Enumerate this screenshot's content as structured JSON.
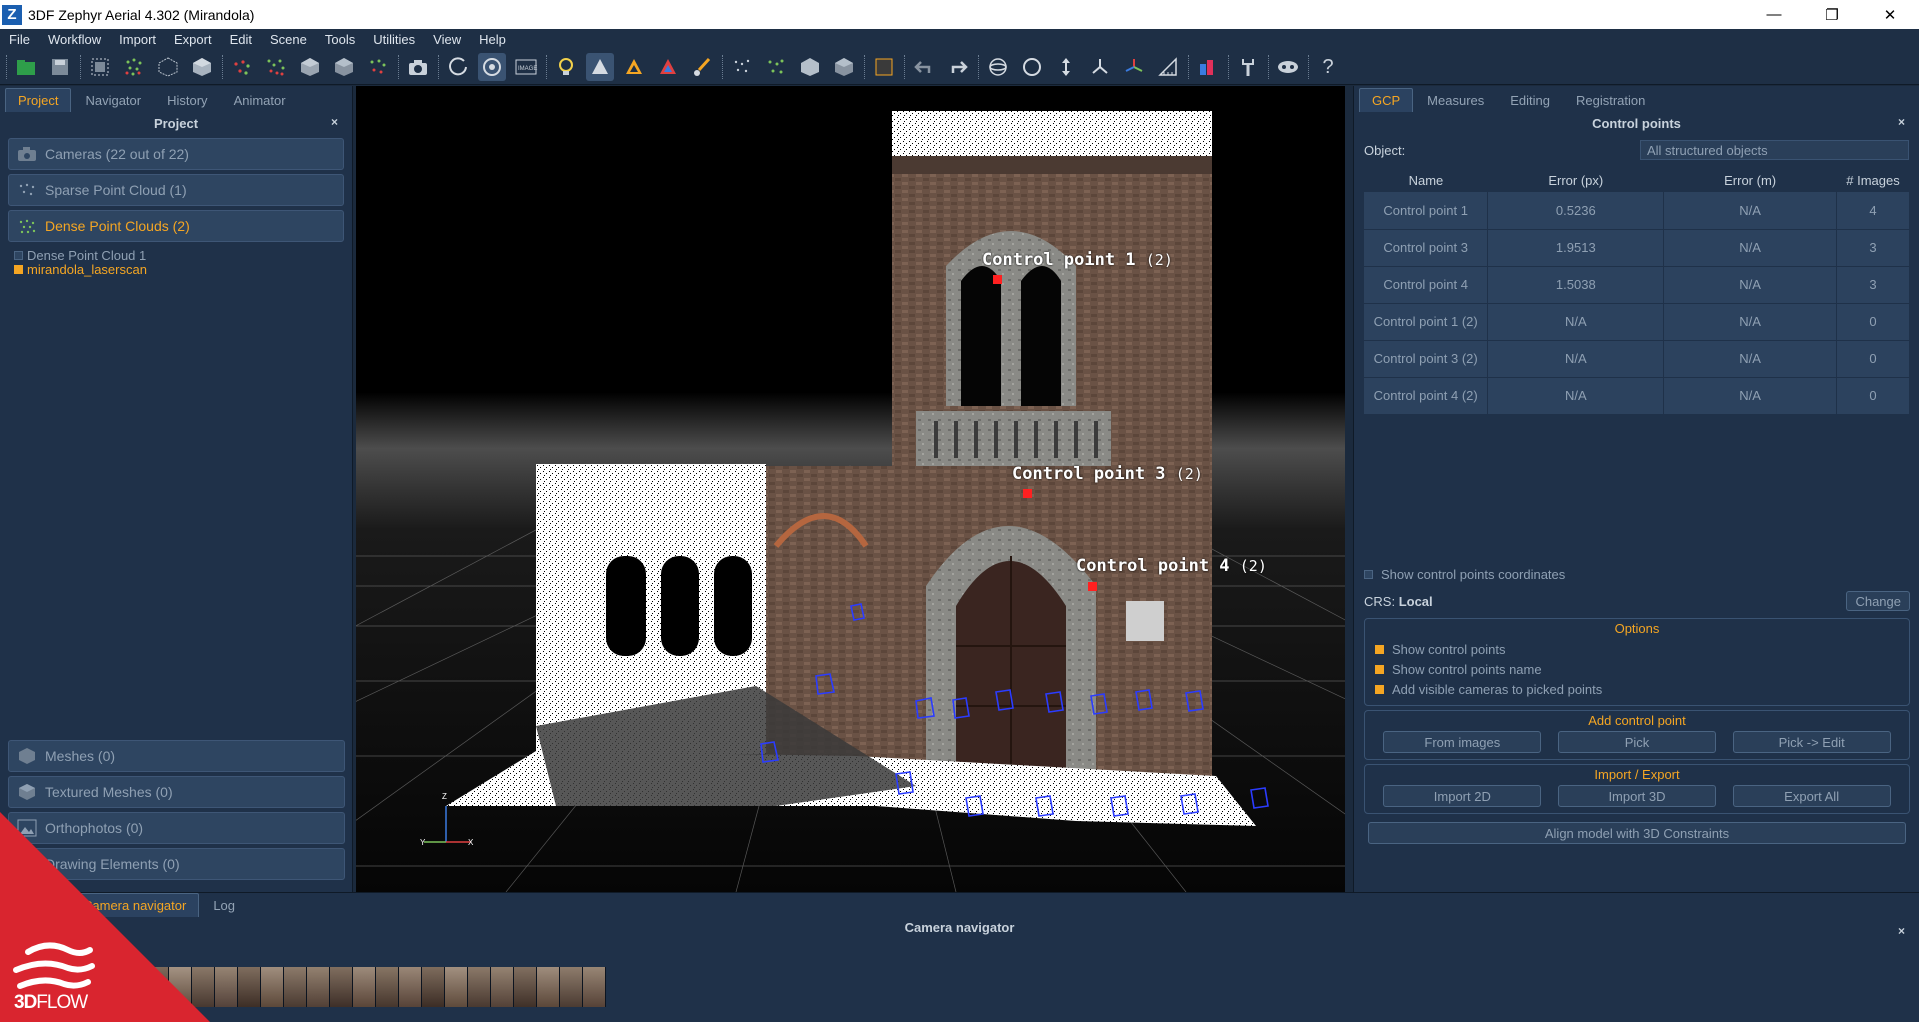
{
  "window": {
    "title": "3DF Zephyr Aerial 4.302 (Mirandola)",
    "logo_letter": "Z",
    "minimize": "—",
    "restore": "❐",
    "close": "✕"
  },
  "menu": [
    "File",
    "Workflow",
    "Import",
    "Export",
    "Edit",
    "Scene",
    "Tools",
    "Utilities",
    "View",
    "Help"
  ],
  "toolbar_icons": [
    "open-project-icon",
    "save-icon",
    "select-region-icon",
    "point-cloud-icon",
    "mesh-icon",
    "cube-icon",
    "sparse-points-icon",
    "dense-points-icon",
    "mesh-solid-icon",
    "textured-mesh-icon",
    "cloud-filter-icon",
    "camera-icon",
    "orbit-icon",
    "pan-rotate-icon",
    "image-icon",
    "light-bulb-icon",
    "point-pick-icon",
    "triangle-icon",
    "color-triangle-icon",
    "brush-icon",
    "dots-icon",
    "points-select-icon",
    "box-icon",
    "box-wire-icon",
    "square-icon",
    "undo-icon",
    "redo-icon",
    "rotate-icon",
    "circle-icon",
    "vertical-arrow-icon",
    "transform-icon",
    "gizmo-icon",
    "measure-icon",
    "analysis-icon",
    "wrench-icon",
    "mask-icon",
    "help-icon"
  ],
  "left": {
    "tabs": [
      "Project",
      "Navigator",
      "History",
      "Animator"
    ],
    "title": "Project",
    "close": "×",
    "sections_top": [
      {
        "label": "Cameras (22 out of 22)",
        "icon": "camera-icon"
      },
      {
        "label": "Sparse Point Cloud (1)",
        "icon": "sparse-cloud-icon"
      },
      {
        "label": "Dense Point Clouds (2)",
        "icon": "dense-cloud-icon"
      }
    ],
    "tree": [
      {
        "label": "Dense Point Cloud 1",
        "checked": false
      },
      {
        "label": "mirandola_laserscan",
        "checked": true
      }
    ],
    "sections_bottom": [
      {
        "label": "Meshes (0)",
        "icon": "mesh-icon"
      },
      {
        "label": "Textured Meshes (0)",
        "icon": "textured-mesh-icon"
      },
      {
        "label": "Orthophotos (0)",
        "icon": "orthophoto-icon"
      },
      {
        "label": "Drawing Elements (0)",
        "icon": "drawing-icon"
      }
    ]
  },
  "viewport": {
    "labels": [
      {
        "name": "Control point 1",
        "suffix": "(2)"
      },
      {
        "name": "Control point 3",
        "suffix": "(2)"
      },
      {
        "name": "Control point 4",
        "suffix": "(2)"
      }
    ],
    "axes": {
      "z": "Z",
      "y": "Y",
      "x": "X"
    }
  },
  "right": {
    "tabs": [
      "GCP",
      "Measures",
      "Editing",
      "Registration"
    ],
    "title": "Control points",
    "close": "×",
    "object_label": "Object:",
    "object_value": "All structured objects",
    "columns": [
      "Name",
      "Error (px)",
      "Error (m)",
      "# Images"
    ],
    "rows": [
      [
        "Control point 1",
        "0.5236",
        "N/A",
        "4"
      ],
      [
        "Control point 3",
        "1.9513",
        "N/A",
        "3"
      ],
      [
        "Control point 4",
        "1.5038",
        "N/A",
        "3"
      ],
      [
        "Control point 1 (2)",
        "N/A",
        "N/A",
        "0"
      ],
      [
        "Control point 3 (2)",
        "N/A",
        "N/A",
        "0"
      ],
      [
        "Control point 4 (2)",
        "N/A",
        "N/A",
        "0"
      ]
    ],
    "show_coords": "Show control points coordinates",
    "crs_label": "CRS:",
    "crs_value": "Local",
    "change": "Change",
    "options_title": "Options",
    "options": [
      "Show control points",
      "Show control points name",
      "Add visible cameras to picked points"
    ],
    "add_title": "Add control point",
    "add_buttons": [
      "From images",
      "Pick",
      "Pick -> Edit"
    ],
    "ie_title": "Import / Export",
    "ie_buttons": [
      "Import 2D",
      "Import 3D",
      "Export All"
    ],
    "align": "Align model with 3D Constraints"
  },
  "bottom": {
    "tabs": [
      "Camera navigator",
      "Log"
    ],
    "title": "Camera navigator",
    "close": "×"
  },
  "brand": {
    "bold": "3D",
    "light": "FLOW"
  },
  "colors": {
    "accent": "#f5a623",
    "panel": "#1f3149",
    "button": "#2e4561",
    "brand_red": "#d9252f"
  }
}
